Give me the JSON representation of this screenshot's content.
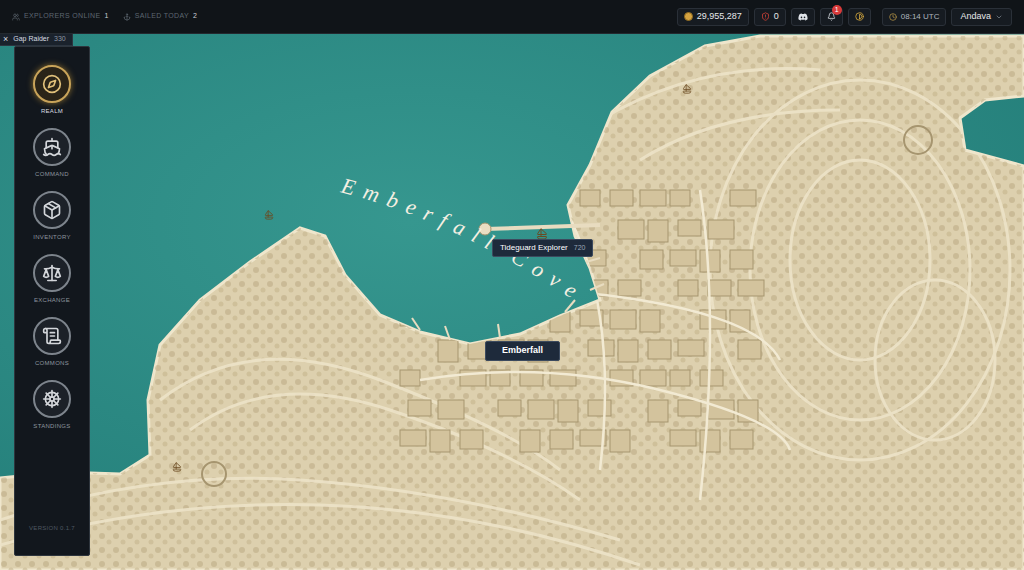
{
  "topbar": {
    "stats": [
      {
        "label": "EXPLORERS ONLINE",
        "value": "1"
      },
      {
        "label": "SAILED TODAY",
        "value": "2"
      }
    ],
    "coins": "29,955,287",
    "alerts": "0",
    "notifications": "1",
    "clock": "08:14 UTC",
    "account": "Andava"
  },
  "tab": {
    "close": "×",
    "title": "Gap Raider",
    "value": "330"
  },
  "sidebar": {
    "items": [
      {
        "label": "REALM",
        "selected": true
      },
      {
        "label": "COMMAND",
        "selected": false
      },
      {
        "label": "INVENTORY",
        "selected": false
      },
      {
        "label": "EXCHANGE",
        "selected": false
      },
      {
        "label": "COMMONS",
        "selected": false
      },
      {
        "label": "STANDINGS",
        "selected": false
      }
    ],
    "version": "VERSION 0.1.7"
  },
  "map": {
    "region": "Emberfall Cove",
    "markers": [
      {
        "label": "Tideguard Explorer",
        "value": "720",
        "kind": "ship"
      },
      {
        "label": "Emberfall",
        "value": "",
        "kind": "town"
      }
    ]
  }
}
